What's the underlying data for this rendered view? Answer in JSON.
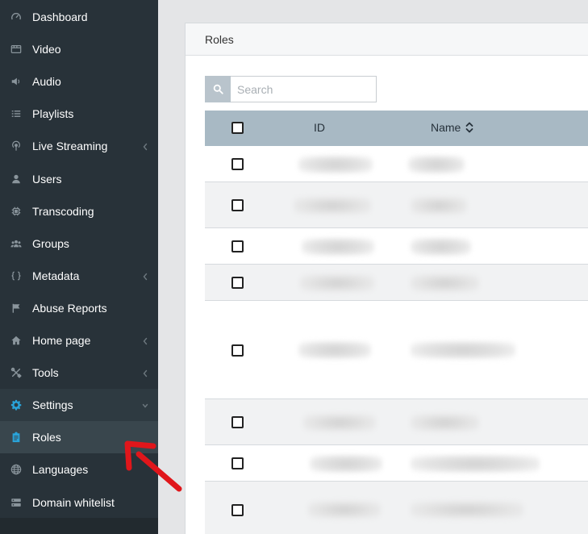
{
  "sidebar": {
    "items": [
      {
        "label": "Dashboard",
        "icon": "gauge-icon",
        "has_chevron": false
      },
      {
        "label": "Video",
        "icon": "film-icon",
        "has_chevron": false
      },
      {
        "label": "Audio",
        "icon": "speaker-icon",
        "has_chevron": false
      },
      {
        "label": "Playlists",
        "icon": "list-icon",
        "has_chevron": false
      },
      {
        "label": "Live Streaming",
        "icon": "broadcast-icon",
        "has_chevron": true
      },
      {
        "label": "Users",
        "icon": "user-icon",
        "has_chevron": false
      },
      {
        "label": "Transcoding",
        "icon": "chip-icon",
        "has_chevron": false
      },
      {
        "label": "Groups",
        "icon": "group-icon",
        "has_chevron": false
      },
      {
        "label": "Metadata",
        "icon": "braces-icon",
        "has_chevron": true
      },
      {
        "label": "Abuse Reports",
        "icon": "flag-icon",
        "has_chevron": false
      },
      {
        "label": "Home page",
        "icon": "home-icon",
        "has_chevron": true
      },
      {
        "label": "Tools",
        "icon": "tools-icon",
        "has_chevron": true
      },
      {
        "label": "Settings",
        "icon": "gear-icon",
        "has_chevron": true,
        "expanded": true
      },
      {
        "label": "Roles",
        "icon": "clipboard-icon",
        "has_chevron": false,
        "active": true
      },
      {
        "label": "Languages",
        "icon": "globe-icon",
        "has_chevron": false
      },
      {
        "label": "Domain whitelist",
        "icon": "server-icon",
        "has_chevron": false
      }
    ]
  },
  "panel": {
    "title": "Roles"
  },
  "search": {
    "placeholder": "Search",
    "value": ""
  },
  "table": {
    "columns": [
      "ID",
      "Name"
    ],
    "rows_blurred": 8
  },
  "colors": {
    "sidebar_bg": "#283239",
    "accent": "#29a3d9",
    "header_bg": "#a8b9c4",
    "annotation_arrow": "#e0161b"
  }
}
